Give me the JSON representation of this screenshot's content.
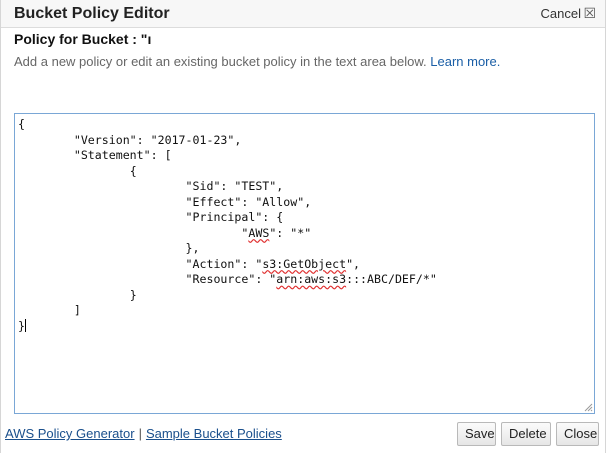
{
  "dialog": {
    "title": "Bucket Policy Editor",
    "cancel_label": "Cancel",
    "close_glyph": "☒",
    "policy_for_label": "Policy for Bucket : \"ı",
    "description": "Add a new policy or edit an existing bucket policy in the text area below.",
    "learn_more": "Learn more."
  },
  "editor": {
    "lines": [
      {
        "plain": "{"
      },
      {
        "plain": "\t\"Version\": \"2017-01-23\","
      },
      {
        "plain": "\t\"Statement\": ["
      },
      {
        "plain": "\t\t{"
      },
      {
        "plain": "\t\t\t\"Sid\": \"TEST\","
      },
      {
        "plain": "\t\t\t\"Effect\": \"Allow\","
      },
      {
        "plain": "\t\t\t\"Principal\": {"
      },
      {
        "pre": "\t\t\t\t\"",
        "sq": "AWS",
        "post": "\": \"*\""
      },
      {
        "plain": "\t\t\t},"
      },
      {
        "pre": "\t\t\t\"Action\": \"",
        "sq": "s3:GetObject",
        "post": "\","
      },
      {
        "pre": "\t\t\t\"Resource\": \"",
        "sq": "arn:aws:s3",
        "post": ":::ABC/DEF/*\""
      },
      {
        "plain": "\t\t}"
      },
      {
        "plain": "\t]"
      },
      {
        "plain": "}",
        "caret": true
      }
    ]
  },
  "footer": {
    "policy_generator": "AWS Policy Generator",
    "separator": "|",
    "sample_policies": "Sample Bucket Policies",
    "save": "Save",
    "delete": "Delete",
    "close": "Close"
  },
  "colors": {
    "link": "#1a5ea6",
    "editor_border": "#7aa7d6",
    "spell_error": "#e03030"
  }
}
